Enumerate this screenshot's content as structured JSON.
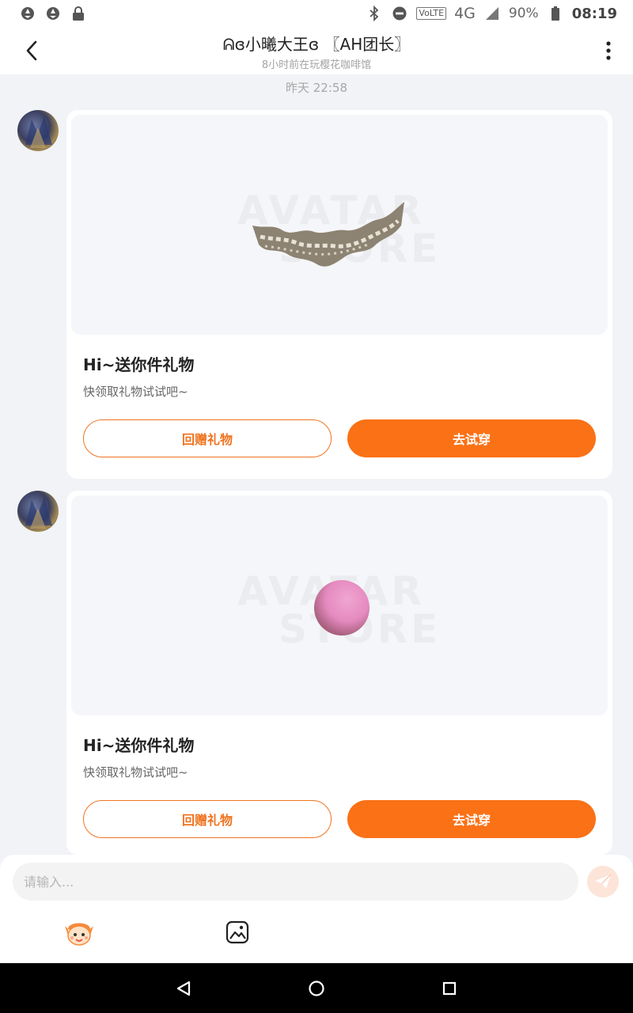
{
  "status_bar": {
    "battery_percent": "90%",
    "time": "08:19",
    "volte": "VoLTE",
    "network": "4G",
    "network_small": "4G",
    "icons": [
      "aperture-icon",
      "aperture-icon",
      "lock-icon",
      "bluetooth-icon",
      "do-not-disturb-icon",
      "signal-icon",
      "battery-icon"
    ]
  },
  "header": {
    "title": "ᕱɞ小曦大王ɞ 〖AH团长〗",
    "subtitle": "8小时前在玩樱花咖啡馆"
  },
  "chat": {
    "timestamp": "昨天 22:58",
    "messages": [
      {
        "gift_item": "lace-crown",
        "title": "Hi~送你件礼物",
        "desc": "快领取礼物试试吧~",
        "return_gift_label": "回赠礼物",
        "try_on_label": "去试穿"
      },
      {
        "gift_item": "pink-ball",
        "title": "Hi~送你件礼物",
        "desc": "快领取礼物试试吧~",
        "return_gift_label": "回赠礼物",
        "try_on_label": "去试穿"
      }
    ],
    "watermark_line1": "AVATAR",
    "watermark_line2": "STORE"
  },
  "input_bar": {
    "placeholder": "请输入..."
  },
  "colors": {
    "accent": "#fa7116",
    "background": "#f1f3f6"
  }
}
